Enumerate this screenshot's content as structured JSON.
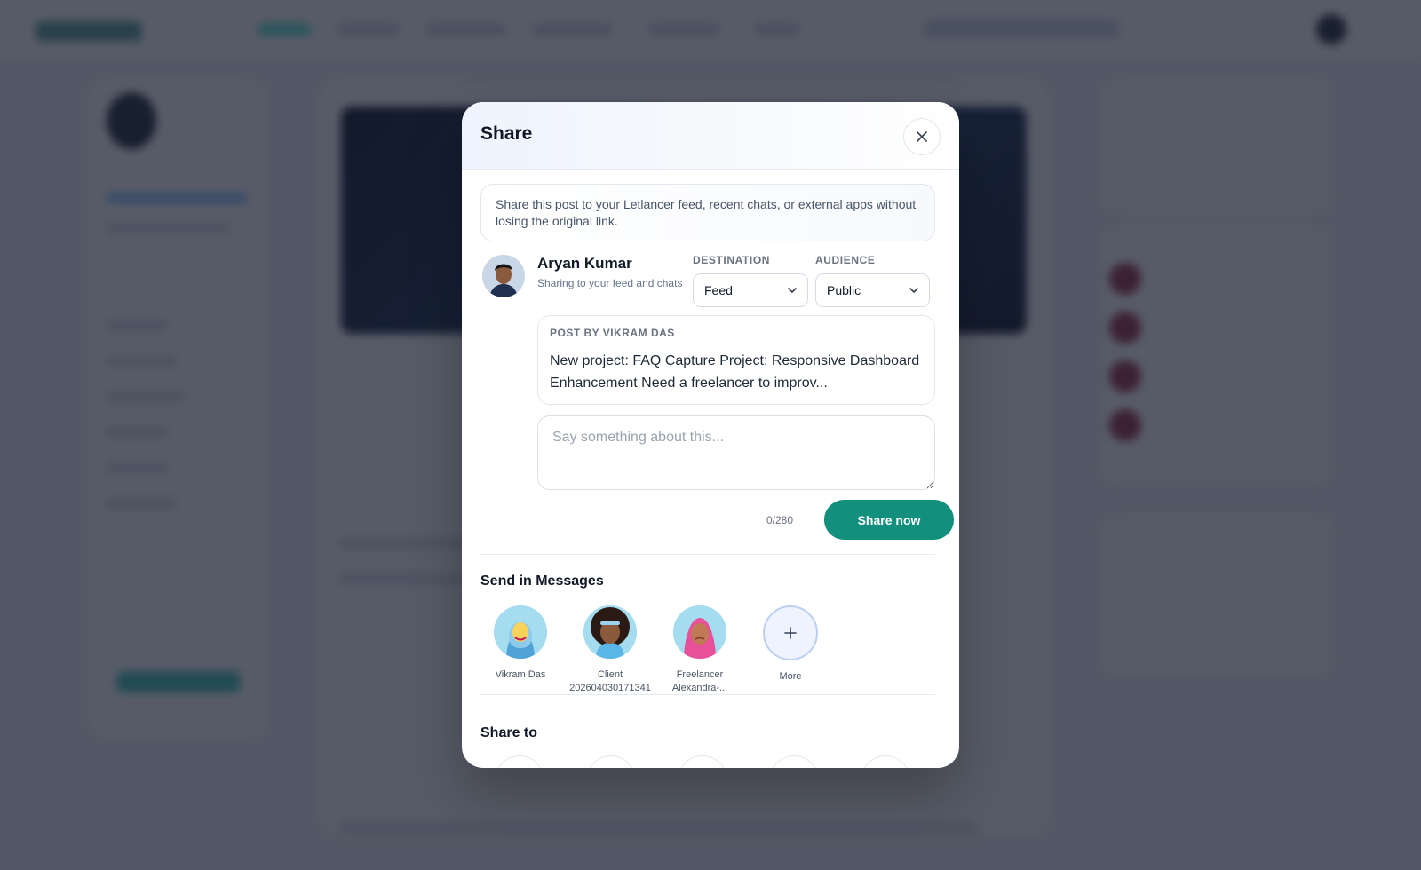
{
  "modal": {
    "title": "Share",
    "description": "Share this post to your Letlancer feed, recent chats, or external apps without losing the original link."
  },
  "sharer": {
    "name": "Aryan Kumar",
    "subtitle": "Sharing to your feed and chats"
  },
  "destination": {
    "label": "DESTINATION",
    "value": "Feed"
  },
  "audience": {
    "label": "AUDIENCE",
    "value": "Public"
  },
  "post": {
    "by_label": "POST BY VIKRAM DAS",
    "text": "New project: FAQ Capture Project: Responsive Dashboard Enhancement Need a freelancer to improv..."
  },
  "comment": {
    "placeholder": "Say something about this...",
    "counter": "0/280"
  },
  "share_button": "Share now",
  "messages": {
    "title": "Send in Messages",
    "contacts": [
      {
        "name": "Vikram Das"
      },
      {
        "name": "Client 202604030171341"
      },
      {
        "name": "Freelancer Alexandra-..."
      }
    ],
    "more_label": "More"
  },
  "share_to": {
    "title": "Share to"
  },
  "colors": {
    "primary": "#128f7d",
    "overlay": "#161c2d"
  }
}
